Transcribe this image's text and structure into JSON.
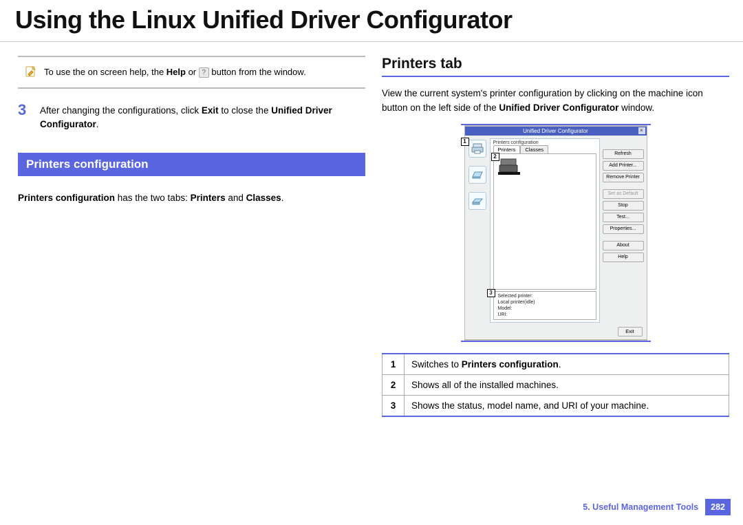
{
  "title": "Using the Linux Unified Driver Configurator",
  "note": {
    "prefix": "To use the on screen help, the ",
    "bold1": "Help",
    "mid": " or ",
    "suffix": " button from the window."
  },
  "step": {
    "num": "3",
    "prefix": "After changing the configurations, click ",
    "bold1": "Exit",
    "mid": " to close the ",
    "bold2": "Unified Driver Configurator",
    "suffix": "."
  },
  "sectionBar": "Printers configuration",
  "configLine": {
    "bold1": "Printers configuration",
    "mid": " has the two tabs: ",
    "bold2": "Printers",
    "and": " and ",
    "bold3": "Classes",
    "suffix": "."
  },
  "rightHeading": "Printers tab",
  "rightPara": {
    "prefix": "View the current system's printer configuration by clicking on the machine icon button on the left side of the ",
    "bold": "Unified Driver Configurator",
    "suffix": " window."
  },
  "shot": {
    "title": "Unified Driver Configurator",
    "headLabel": "Printers configuration",
    "tab1": "Printers",
    "tab2": "Classes",
    "infoHead": "Selected printer:",
    "infoLine1": "Local printer(idle)",
    "infoLine2": "Model:",
    "infoLine3": "URI:",
    "callout1": "1",
    "callout2": "2",
    "callout3": "3",
    "buttons": {
      "refresh": "Refresh",
      "add": "Add Printer...",
      "remove": "Remove Printer",
      "setdefault": "Set as Default",
      "stop": "Stop",
      "test": "Test...",
      "properties": "Properties...",
      "about": "About",
      "help": "Help",
      "exit": "Exit"
    }
  },
  "table": {
    "r1n": "1",
    "r1a": "Switches to ",
    "r1b": "Printers configuration",
    "r1c": ".",
    "r2n": "2",
    "r2": "Shows all of the installed machines.",
    "r3n": "3",
    "r3": "Shows the status, model name, and URI of your machine."
  },
  "footer": {
    "chapter": "5.  Useful Management Tools",
    "page": "282"
  }
}
